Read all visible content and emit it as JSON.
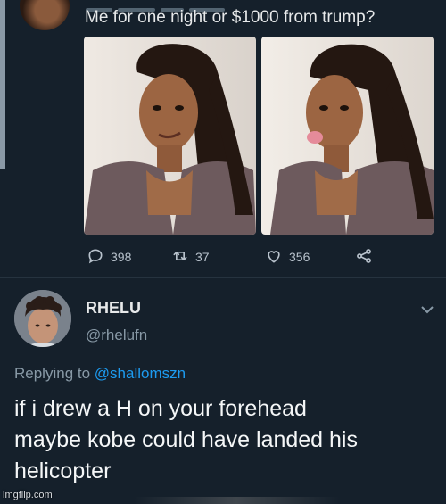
{
  "tweet": {
    "text": "Me for one night or $1000 from trump?",
    "stats": {
      "replies": "398",
      "retweets": "37",
      "likes": "356"
    }
  },
  "reply": {
    "name": "RHELU",
    "handle": "@rhelufn",
    "replying_prefix": "Replying to",
    "replying_to": "@shallomszn",
    "body_lines": [
      "if i drew a H on your forehead",
      "maybe kobe could have landed his",
      "helicopter"
    ]
  },
  "watermark": "imgflip.com",
  "colors": {
    "background": "#15202b",
    "mention": "#1d9bf0",
    "secondary_text": "#8899a6"
  },
  "icons": [
    "reply-icon",
    "retweet-icon",
    "like-icon",
    "share-icon",
    "chevron-down-icon"
  ]
}
